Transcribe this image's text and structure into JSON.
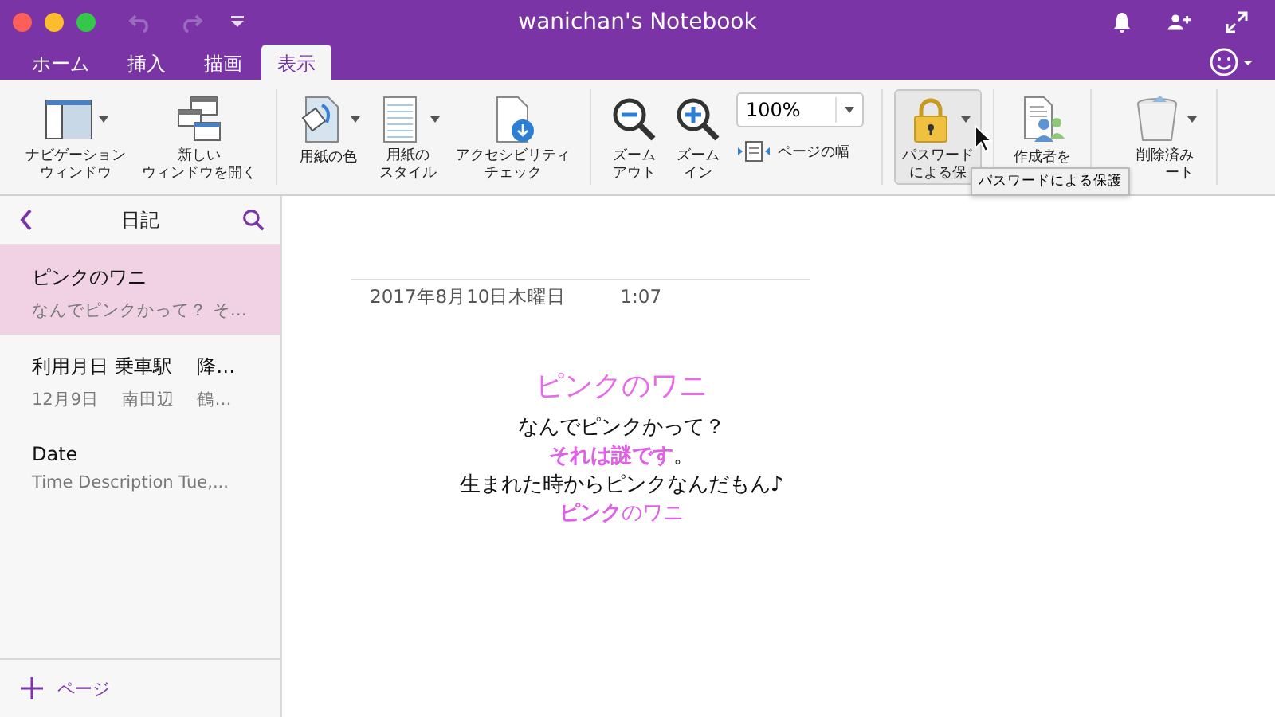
{
  "window": {
    "title": "wanichan's Notebook"
  },
  "tabs": [
    {
      "label": "ホーム",
      "selected": false
    },
    {
      "label": "挿入",
      "selected": false
    },
    {
      "label": "描画",
      "selected": false
    },
    {
      "label": "表示",
      "selected": true
    }
  ],
  "ribbon": {
    "groups": [
      [
        {
          "kind": "nav",
          "lines": [
            "ナビゲーション",
            "ウィンドウ"
          ],
          "dropdown": true
        },
        {
          "kind": "newwin",
          "lines": [
            "新しい",
            "ウィンドウを開く"
          ],
          "dropdown": false
        }
      ],
      [
        {
          "kind": "papercolor",
          "lines": [
            "用紙の色"
          ],
          "dropdown": true
        },
        {
          "kind": "paperstyle",
          "lines": [
            "用紙の",
            "スタイル"
          ],
          "dropdown": true
        },
        {
          "kind": "access",
          "lines": [
            "アクセシビリティ",
            "チェック"
          ],
          "dropdown": false
        }
      ],
      [
        {
          "kind": "zoomout",
          "lines": [
            "ズーム",
            "アウト"
          ],
          "dropdown": false
        },
        {
          "kind": "zoomin",
          "lines": [
            "ズーム",
            "イン"
          ],
          "dropdown": false
        },
        {
          "kind": "zoombox",
          "value": "100%",
          "width_label": "ページの幅"
        }
      ],
      [
        {
          "kind": "lock",
          "lines": [
            "パスワード",
            "による保"
          ],
          "dropdown": true,
          "selected": true
        }
      ],
      [
        {
          "kind": "authors",
          "lines": [
            "作成者を"
          ],
          "dropdown": false
        }
      ],
      [
        {
          "kind": "trash",
          "lines": [
            "削除済み",
            "ート"
          ],
          "dropdown": true
        }
      ]
    ],
    "tooltip": "パスワードによる保護"
  },
  "sidebar": {
    "title": "日記",
    "pages": [
      {
        "title": "ピンクのワニ",
        "preview": "なんでピンクかって？ そ…",
        "selected": true
      },
      {
        "title": "利用月日 乗車駅　 降…",
        "preview": "12月9日　 南田辺　 鶴…",
        "selected": false
      },
      {
        "title": "Date",
        "preview": "Time  Description  Tue,...",
        "selected": false
      }
    ],
    "add_label": "ページ"
  },
  "page": {
    "date": "2017年8月10日木曜日",
    "time": "1:07",
    "heading": "ピンクのワニ",
    "lines": [
      [
        {
          "text": "なんでピンクかって？",
          "accent": false,
          "bold": false
        }
      ],
      [
        {
          "text": "それは謎です",
          "accent": true,
          "bold": true
        },
        {
          "text": "。",
          "accent": false,
          "bold": false
        }
      ],
      [
        {
          "text": "生まれた時からピンクなんだもん♪",
          "accent": false,
          "bold": false
        }
      ],
      [
        {
          "text": "ピンク",
          "accent": true,
          "bold": true
        },
        {
          "text": "のワニ",
          "accent": true,
          "bold": false
        }
      ]
    ]
  }
}
